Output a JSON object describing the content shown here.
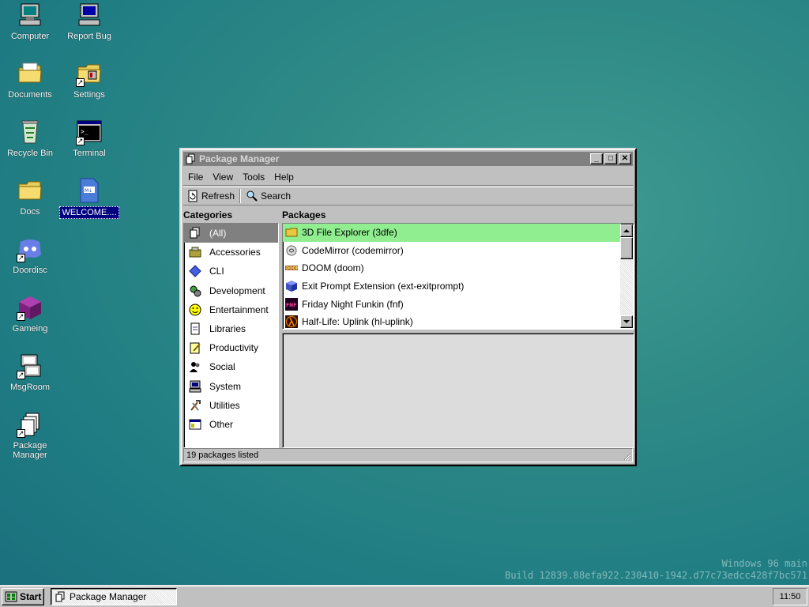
{
  "desktop": {
    "icons": [
      {
        "label": "Computer",
        "icon": "computer-icon"
      },
      {
        "label": "Report Bug",
        "icon": "report-bug-icon"
      },
      {
        "label": "Documents",
        "icon": "documents-folder-icon"
      },
      {
        "label": "Settings",
        "icon": "settings-folder-icon"
      },
      {
        "label": "Recycle Bin",
        "icon": "recycle-bin-icon"
      },
      {
        "label": "Terminal",
        "icon": "terminal-icon"
      },
      {
        "label": "Docs",
        "icon": "docs-folder-icon"
      },
      {
        "label": "WELCOME....",
        "icon": "markdown-file-icon"
      },
      {
        "label": "Doordisc",
        "icon": "doordisc-icon"
      },
      {
        "label": "Gameing",
        "icon": "gameing-cube-icon"
      },
      {
        "label": "MsgRoom",
        "icon": "msgroom-icon"
      },
      {
        "label": "Package Manager",
        "icon": "package-manager-icon"
      }
    ]
  },
  "window": {
    "title": "Package Manager",
    "menu": [
      "File",
      "View",
      "Tools",
      "Help"
    ],
    "toolbar": {
      "refresh_label": "Refresh",
      "search_label": "Search"
    },
    "categories_header": "Categories",
    "packages_header": "Packages",
    "categories": [
      "(All)",
      "Accessories",
      "CLI",
      "Development",
      "Entertainment",
      "Libraries",
      "Productivity",
      "Social",
      "System",
      "Utilities",
      "Other"
    ],
    "packages": [
      "3D File Explorer (3dfe)",
      "CodeMirror (codemirror)",
      "DOOM (doom)",
      "Exit Prompt Extension (ext-exitprompt)",
      "Friday Night Funkin (fnf)",
      "Half-Life: Uplink (hl-uplink)"
    ],
    "status": "19 packages listed"
  },
  "taskbar": {
    "start_label": "Start",
    "task_label": "Package Manager",
    "clock": "11:50"
  },
  "watermark": {
    "line1": "Windows 96 main",
    "line2": "Build 12839.88efa922.230410-1942.d77c73edcc428f7bc571"
  },
  "colors": {
    "selected_package": "#90ee90",
    "selected_category": "#808080",
    "title_inactive": "#808080"
  }
}
